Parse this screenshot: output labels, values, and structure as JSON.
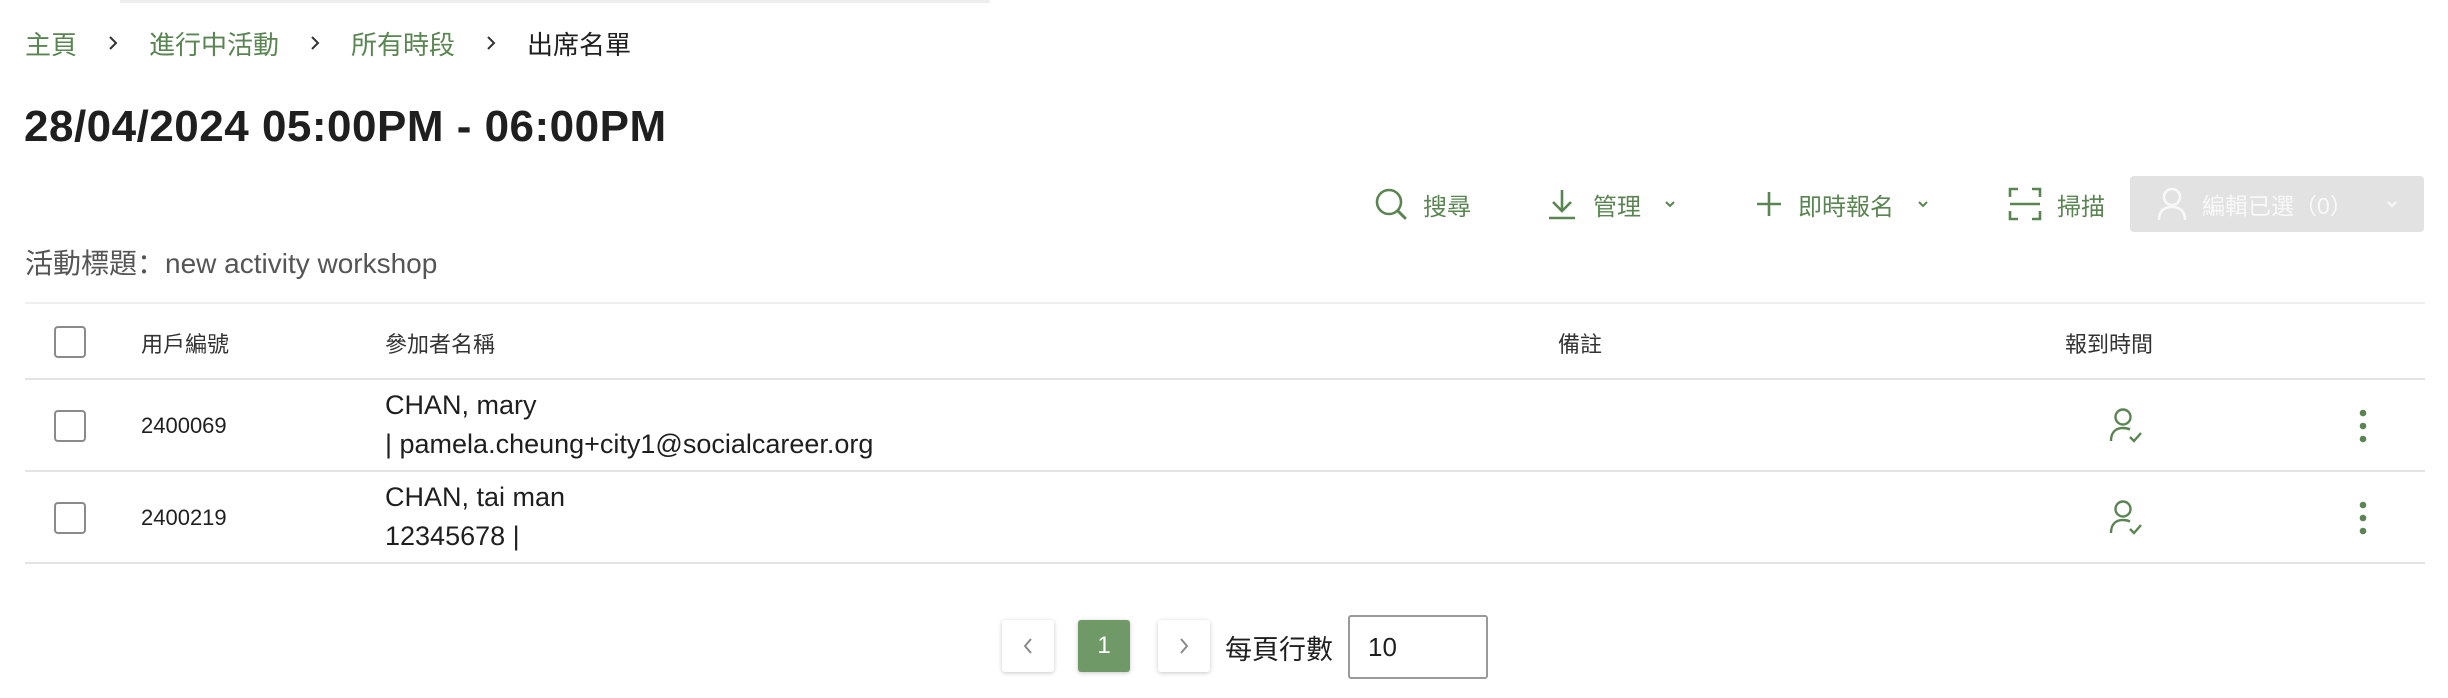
{
  "breadcrumb": {
    "home": "主頁",
    "ongoing": "進行中活動",
    "all_sessions": "所有時段",
    "current": "出席名單"
  },
  "page": {
    "title": "28/04/2024 05:00PM - 06:00PM",
    "activity_line": "活動標題：new activity workshop"
  },
  "toolbar": {
    "search_label": "搜尋",
    "manage_label": "管理",
    "walkin_label": "即時報名",
    "scan_label": "掃描",
    "edit_selected_label": "編輯已選（0）"
  },
  "colors": {
    "accent": "#5a8552",
    "active_page": "#6f9a68",
    "disabled_bg": "#e2e2e2"
  },
  "table": {
    "headers": {
      "user_id": "用戶編號",
      "participant_name": "參加者名稱",
      "remarks": "備註",
      "checkin_time": "報到時間"
    },
    "rows": [
      {
        "user_id": "2400069",
        "name": "CHAN, mary",
        "contact": "| pamela.cheung+city1@socialcareer.org",
        "remarks": ""
      },
      {
        "user_id": "2400219",
        "name": "CHAN, tai man",
        "contact": "12345678 |",
        "remarks": ""
      }
    ]
  },
  "pagination": {
    "current_page": "1",
    "rows_per_page_label": "每頁行數",
    "rows_per_page_value": "10"
  }
}
